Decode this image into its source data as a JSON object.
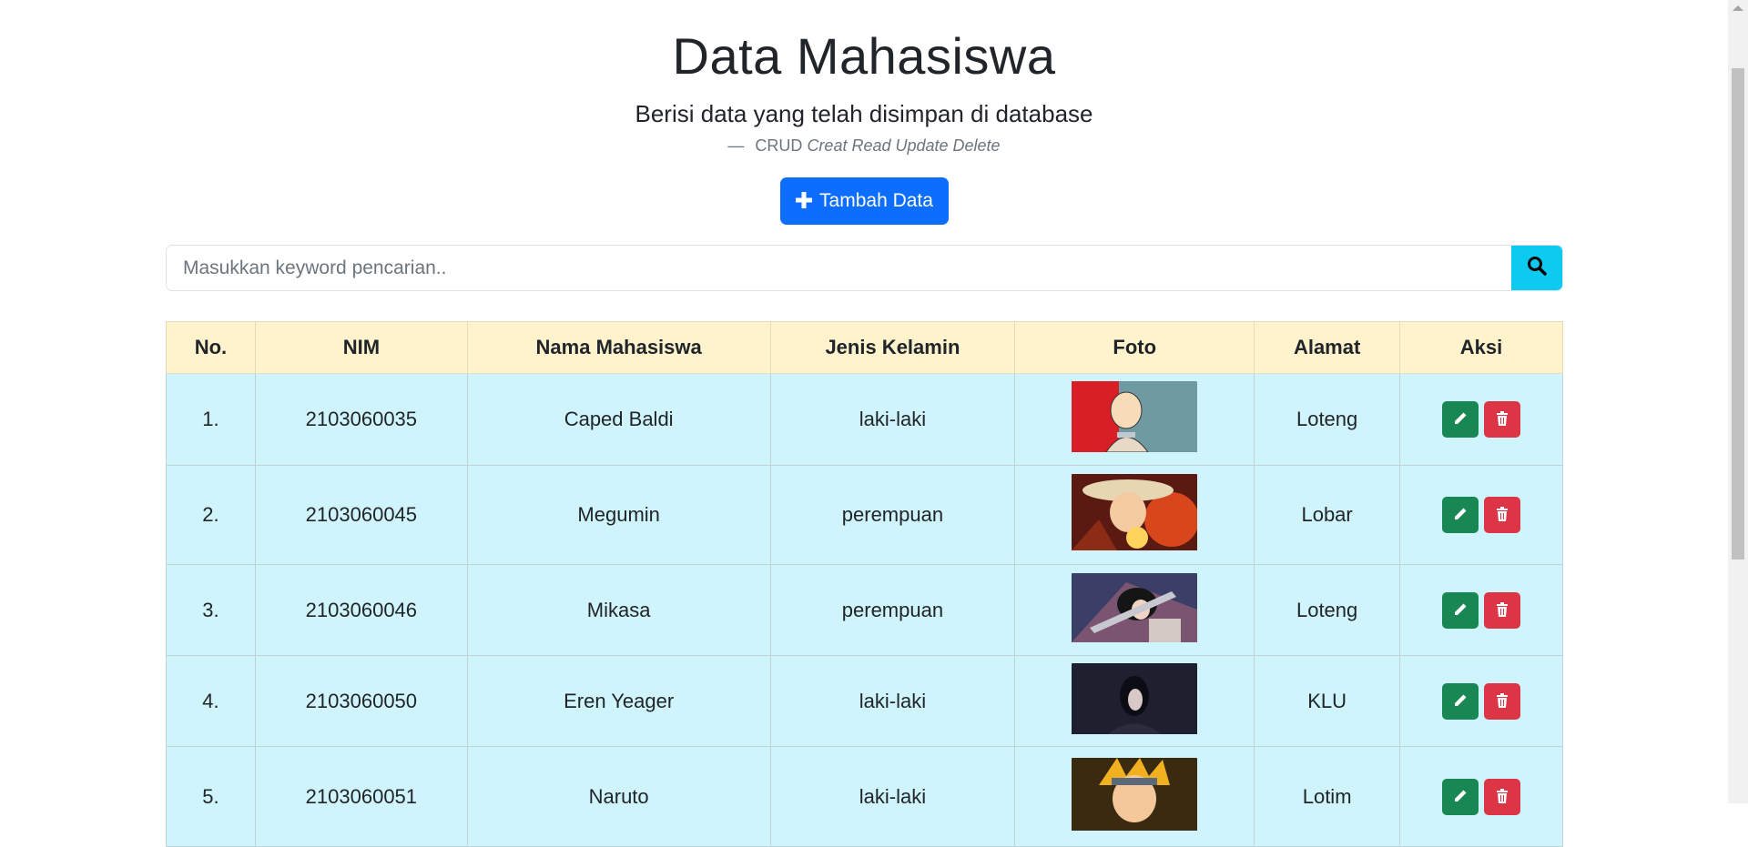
{
  "header": {
    "title": "Data Mahasiswa",
    "lead": "Berisi data yang telah disimpan di database",
    "footer_prefix": "CRUD",
    "footer_italic": "Creat Read Update Delete"
  },
  "add_button": {
    "label": "Tambah Data"
  },
  "search": {
    "placeholder": "Masukkan keyword pencarian.."
  },
  "table": {
    "headers": [
      "No.",
      "NIM",
      "Nama Mahasiswa",
      "Jenis Kelamin",
      "Foto",
      "Alamat",
      "Aksi"
    ],
    "rows": [
      {
        "no": "1.",
        "nim": "2103060035",
        "nama": "Caped Baldi",
        "jk": "laki-laki",
        "alamat": "Loteng",
        "foto": "photo-caped-baldi"
      },
      {
        "no": "2.",
        "nim": "2103060045",
        "nama": "Megumin",
        "jk": "perempuan",
        "alamat": "Lobar",
        "foto": "photo-megumin"
      },
      {
        "no": "3.",
        "nim": "2103060046",
        "nama": "Mikasa",
        "jk": "perempuan",
        "alamat": "Loteng",
        "foto": "photo-mikasa"
      },
      {
        "no": "4.",
        "nim": "2103060050",
        "nama": "Eren Yeager",
        "jk": "laki-laki",
        "alamat": "KLU",
        "foto": "photo-eren"
      },
      {
        "no": "5.",
        "nim": "2103060051",
        "nama": "Naruto",
        "jk": "laki-laki",
        "alamat": "Lotim",
        "foto": "photo-naruto"
      }
    ]
  },
  "icons": {
    "add": "plus-icon",
    "search": "search-icon",
    "edit": "pencil-icon",
    "delete": "trash-icon"
  },
  "colors": {
    "primary": "#0d6efd",
    "info": "#0dcaf0",
    "success": "#198754",
    "danger": "#dc3545",
    "table_head": "#fff3cd",
    "table_body": "#cff4fc"
  }
}
